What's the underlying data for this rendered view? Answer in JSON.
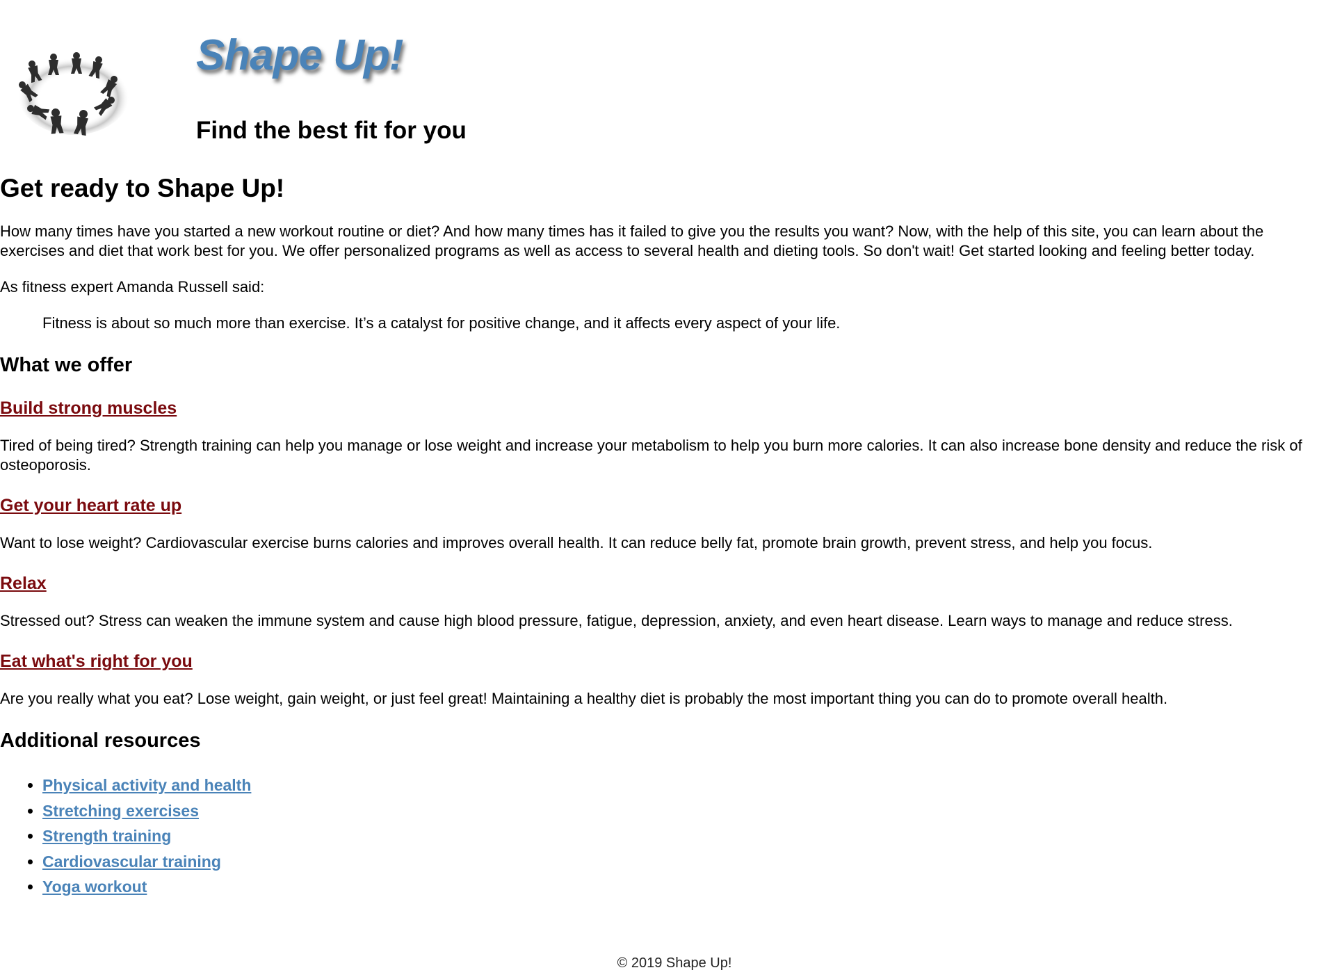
{
  "header": {
    "logo_icon": "people-circle-logo",
    "title": "Shape Up!",
    "tagline": "Find the best fit for you"
  },
  "main": {
    "heading": "Get ready to Shape Up!",
    "intro": "How many times have you started a new workout routine or diet? And how many times has it failed to give you the results you want? Now, with the help of this site, you can learn about the exercises and diet that work best for you. We offer personalized programs as well as access to several health and dieting tools. So don't wait! Get started looking and feeling better today.",
    "quote_intro": "As fitness expert Amanda Russell said:",
    "quote": "Fitness is about so much more than exercise. It’s a catalyst for positive change, and it affects every aspect of your life.",
    "offer_heading": "What we offer",
    "offers": [
      {
        "title": "Build strong muscles",
        "text": "Tired of being tired? Strength training can help you manage or lose weight and increase your metabolism to help you burn more calories. It can also increase bone density and reduce the risk of osteoporosis."
      },
      {
        "title": "Get your heart rate up",
        "text": "Want to lose weight? Cardiovascular exercise burns calories and improves overall health. It can reduce belly fat, promote brain growth, prevent stress, and help you focus."
      },
      {
        "title": "Relax",
        "text": "Stressed out? Stress can weaken the immune system and cause high blood pressure, fatigue, depression, anxiety, and even heart disease. Learn ways to manage and reduce stress."
      },
      {
        "title": "Eat what's right for you",
        "text": "Are you really what you eat? Lose weight, gain weight, or just feel great! Maintaining a healthy diet is probably the most important thing you can do to promote overall health."
      }
    ],
    "resources_heading": "Additional resources",
    "resources": [
      "Physical activity and health",
      "Stretching exercises",
      "Strength training",
      "Cardiovascular training",
      "Yoga workout"
    ]
  },
  "footer": {
    "copyright": "© 2019 Shape Up!"
  },
  "colors": {
    "title_blue": "#4a83b8",
    "offer_link": "#7a0a0e",
    "resource_link": "#4a83b8"
  }
}
